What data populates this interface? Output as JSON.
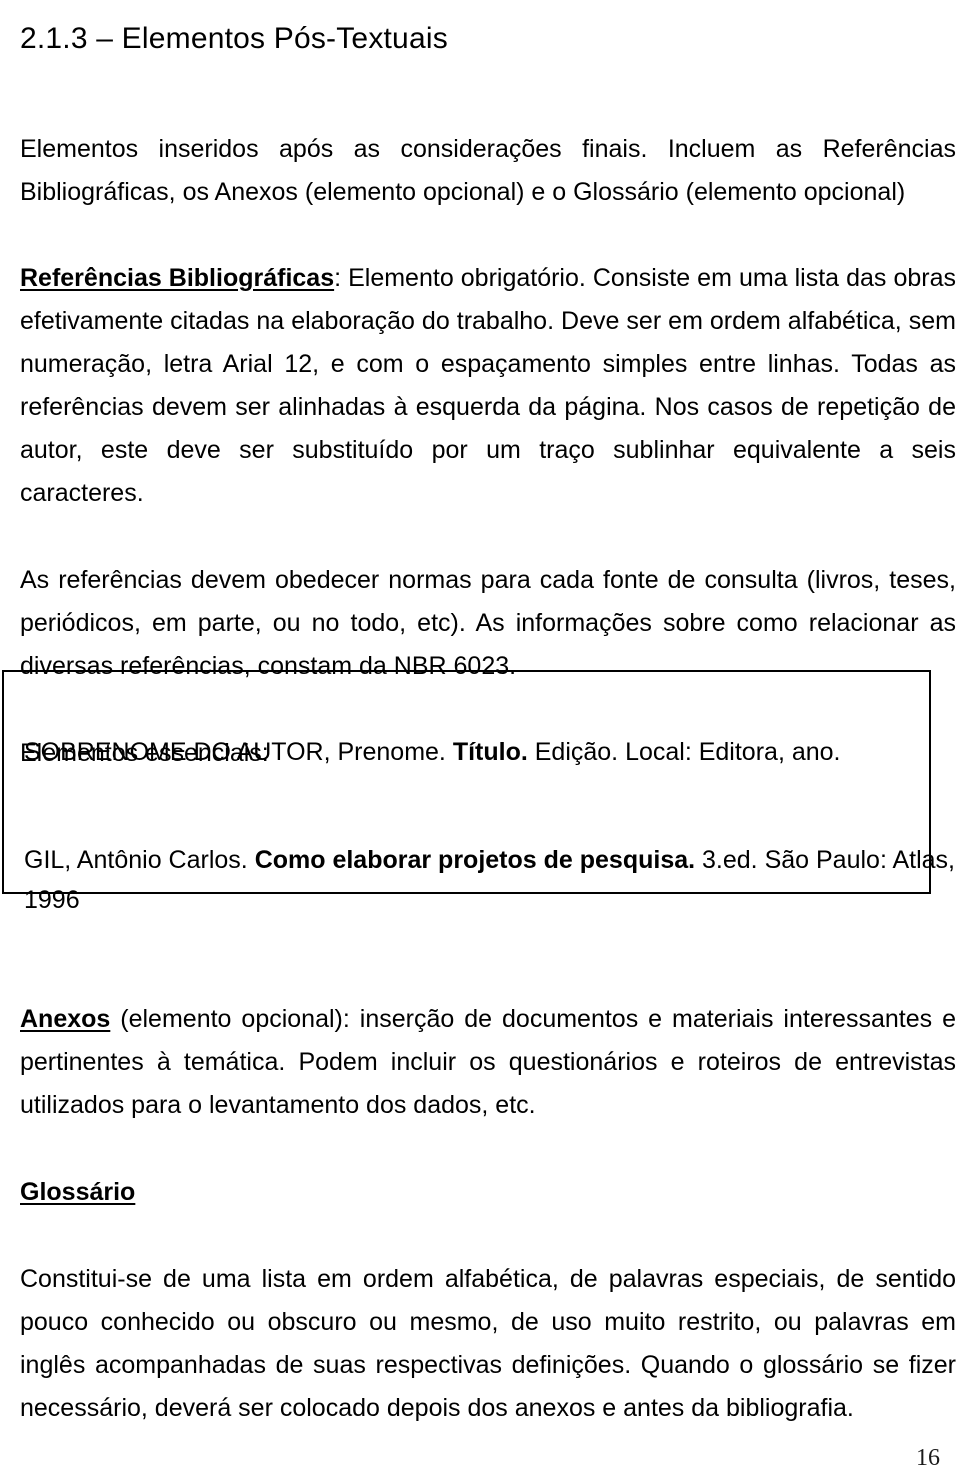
{
  "document": {
    "title": "2.1.3 – Elementos Pós-Textuais",
    "page_number": "16",
    "text_color": "#000000",
    "background_color": "#ffffff",
    "box_border_color": "#000000"
  },
  "intro_paragraph": {
    "text": "Elementos inseridos após as considerações finais. Incluem as Referências Bibliográficas, os Anexos (elemento opcional) e o Glossário (elemento opcional)"
  },
  "references_section": {
    "heading": "Referências Bibliográficas",
    "heading_suffix": ":",
    "body": " Elemento obrigatório. Consiste em uma lista das obras efetivamente citadas na elaboração do trabalho. Deve ser em ordem alfabética, sem numeração, letra Arial 12, e com o espaçamento simples entre linhas. Todas as referências devem ser alinhadas à esquerda da página. Nos casos de repetição de autor, este deve ser substituído por um traço sublinhar equivalente a seis caracteres.",
    "norms_paragraph": "As referências devem obedecer normas para cada fonte de consulta (livros, teses, periódicos, em parte, ou no todo, etc). As informações sobre como relacionar as diversas referências, constam da NBR 6023."
  },
  "example_box": {
    "label": "Elementos essenciais:",
    "pattern": {
      "before_title": "SOBRENOME DO AUTOR, Prenome. ",
      "title_bold": "Título.",
      "after_title": " Edição. Local: Editora, ano."
    },
    "sample": {
      "before_title": "GIL, Antônio Carlos. ",
      "title_bold": "Como elaborar projetos de pesquisa.",
      "after_title": " 3.ed. São Paulo: Atlas, 1996"
    }
  },
  "annexes_section": {
    "heading": "Anexos",
    "body": " (elemento opcional): inserção de documentos e materiais interessantes e pertinentes à temática. Podem incluir os questionários e roteiros de entrevistas utilizados para o levantamento dos dados, etc."
  },
  "glossary_section": {
    "heading": "Glossário",
    "body": "Constitui-se de uma lista em ordem alfabética, de palavras especiais, de sentido pouco conhecido ou obscuro ou mesmo, de uso muito restrito, ou palavras em inglês acompanhadas de suas respectivas definições. Quando o glossário se fizer necessário, deverá ser colocado depois dos anexos e antes da bibliografia."
  }
}
